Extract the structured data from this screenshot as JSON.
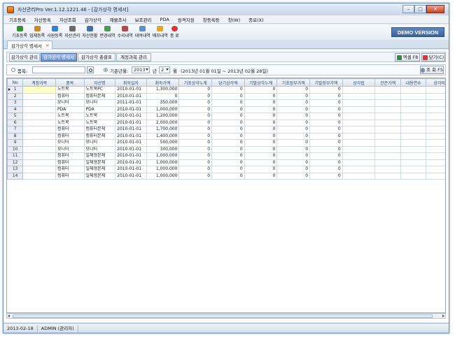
{
  "window": {
    "title": "자산관리Pro Ver.1.12.1221.46 - [감가상각 명세서]"
  },
  "window_controls": {
    "minimize": "–",
    "maximize": "□",
    "close": "✕"
  },
  "menu": [
    "기초등록",
    "자산등록",
    "자산조회",
    "감가상각",
    "재물조사",
    "보조관리",
    "PDA",
    "원격지원",
    "창등록등",
    "창(W)",
    "종료(X)"
  ],
  "toolbar": [
    {
      "label": "기초등록",
      "icon": "base-register-icon",
      "color": "#3d8c3d"
    },
    {
      "label": "업체등록",
      "icon": "company-register-icon",
      "color": "#c98a2a"
    },
    {
      "label": "사원등록",
      "icon": "employee-register-icon",
      "color": "#3b7fc8"
    },
    {
      "label": "자산관리",
      "icon": "asset-manage-icon",
      "color": "#6b6b6b"
    },
    {
      "label": "자산현황",
      "icon": "asset-status-icon",
      "color": "#4a6fa5"
    },
    {
      "label": "변경내역",
      "icon": "change-history-icon",
      "color": "#4b9a5b"
    },
    {
      "label": "수리내역",
      "icon": "repair-history-icon",
      "color": "#b04a4a"
    },
    {
      "label": "대여내역",
      "icon": "rental-history-icon",
      "color": "#5d8fc4"
    },
    {
      "label": "메모내역",
      "icon": "memo-history-icon",
      "color": "#d8a93a"
    },
    {
      "label": "종 료",
      "icon": "exit-icon",
      "color": "#d03a3a"
    }
  ],
  "demo_badge": "DEMO VERSION",
  "doc_tab": {
    "label": "감가상각 명세서",
    "close": "×"
  },
  "subtabs": [
    {
      "label": "감가상각 관리",
      "active": false
    },
    {
      "label": "감가상각 명세서",
      "active": true
    },
    {
      "label": "감가상각 총괄표",
      "active": false
    },
    {
      "label": "계정과목 관리",
      "active": false
    }
  ],
  "buttons": {
    "excel": "엑셀 F8",
    "close": "닫기(C)",
    "search": "조 회 F5"
  },
  "filter": {
    "item_label": "품목:",
    "item_value": "",
    "base_date_label": "기준년월:",
    "year": "2013",
    "year_unit": "년",
    "month": "2",
    "month_unit": "월",
    "period": "(2013년 01월 01일 ~ 2013년 02월 28일)"
  },
  "grid": {
    "columns": [
      "No",
      "계정과목",
      "품목",
      "자산명",
      "취득일자",
      "취득가액",
      "기초상각누계",
      "당기상각액",
      "기말상각누계",
      "기초장부가액",
      "기말장부가액",
      "상각법",
      "잔존가액",
      "내용연수",
      "상각비"
    ],
    "rows": [
      [
        "1",
        "",
        "노트북",
        "노트북PC",
        "2010-01-01",
        "1,300,000",
        "0",
        "0",
        "0",
        "0",
        "0",
        "",
        "",
        "",
        ""
      ],
      [
        "2",
        "",
        "컴퓨터",
        "컴퓨터본체",
        "2010-01-01",
        "0",
        "0",
        "0",
        "0",
        "0",
        "0",
        "",
        "",
        "",
        ""
      ],
      [
        "3",
        "",
        "모니터",
        "모니터",
        "2011-01-01",
        "350,000",
        "0",
        "0",
        "0",
        "0",
        "0",
        "",
        "",
        "",
        ""
      ],
      [
        "4",
        "",
        "PDA",
        "PDA",
        "2010-01-01",
        "1,000,000",
        "0",
        "0",
        "0",
        "0",
        "0",
        "",
        "",
        "",
        ""
      ],
      [
        "5",
        "",
        "노트북",
        "노트북",
        "2010-01-01",
        "1,200,000",
        "0",
        "0",
        "0",
        "0",
        "0",
        "",
        "",
        "",
        ""
      ],
      [
        "6",
        "",
        "노트북",
        "노트북",
        "2010-01-01",
        "2,000,000",
        "0",
        "0",
        "0",
        "0",
        "0",
        "",
        "",
        "",
        ""
      ],
      [
        "7",
        "",
        "컴퓨터",
        "컴퓨터본체",
        "2010-01-01",
        "1,700,000",
        "0",
        "0",
        "0",
        "0",
        "0",
        "",
        "",
        "",
        ""
      ],
      [
        "8",
        "",
        "컴퓨터",
        "컴퓨터본체",
        "2010-01-01",
        "1,400,000",
        "0",
        "0",
        "0",
        "0",
        "0",
        "",
        "",
        "",
        ""
      ],
      [
        "9",
        "",
        "모니터",
        "모니터",
        "2010-01-01",
        "500,000",
        "0",
        "0",
        "0",
        "0",
        "0",
        "",
        "",
        "",
        ""
      ],
      [
        "10",
        "",
        "모니터",
        "모니터",
        "2010-01-01",
        "300,000",
        "0",
        "0",
        "0",
        "0",
        "0",
        "",
        "",
        "",
        ""
      ],
      [
        "11",
        "",
        "컴퓨터",
        "일체형본체",
        "2010-01-01",
        "1,000,000",
        "0",
        "0",
        "0",
        "0",
        "0",
        "",
        "",
        "",
        ""
      ],
      [
        "12",
        "",
        "컴퓨터",
        "일체형본체",
        "2010-01-01",
        "1,000,000",
        "0",
        "0",
        "0",
        "0",
        "0",
        "",
        "",
        "",
        ""
      ],
      [
        "13",
        "",
        "컴퓨터",
        "일체형본체",
        "2010-01-01",
        "1,000,000",
        "0",
        "0",
        "0",
        "0",
        "0",
        "",
        "",
        "",
        ""
      ],
      [
        "14",
        "",
        "컴퓨터",
        "일체형본체",
        "2010-01-01",
        "1,000,000",
        "0",
        "0",
        "0",
        "0",
        "0",
        "",
        "",
        "",
        ""
      ]
    ]
  },
  "status": {
    "date": "2013-02-18",
    "user": "ADMIN (관리자)"
  }
}
